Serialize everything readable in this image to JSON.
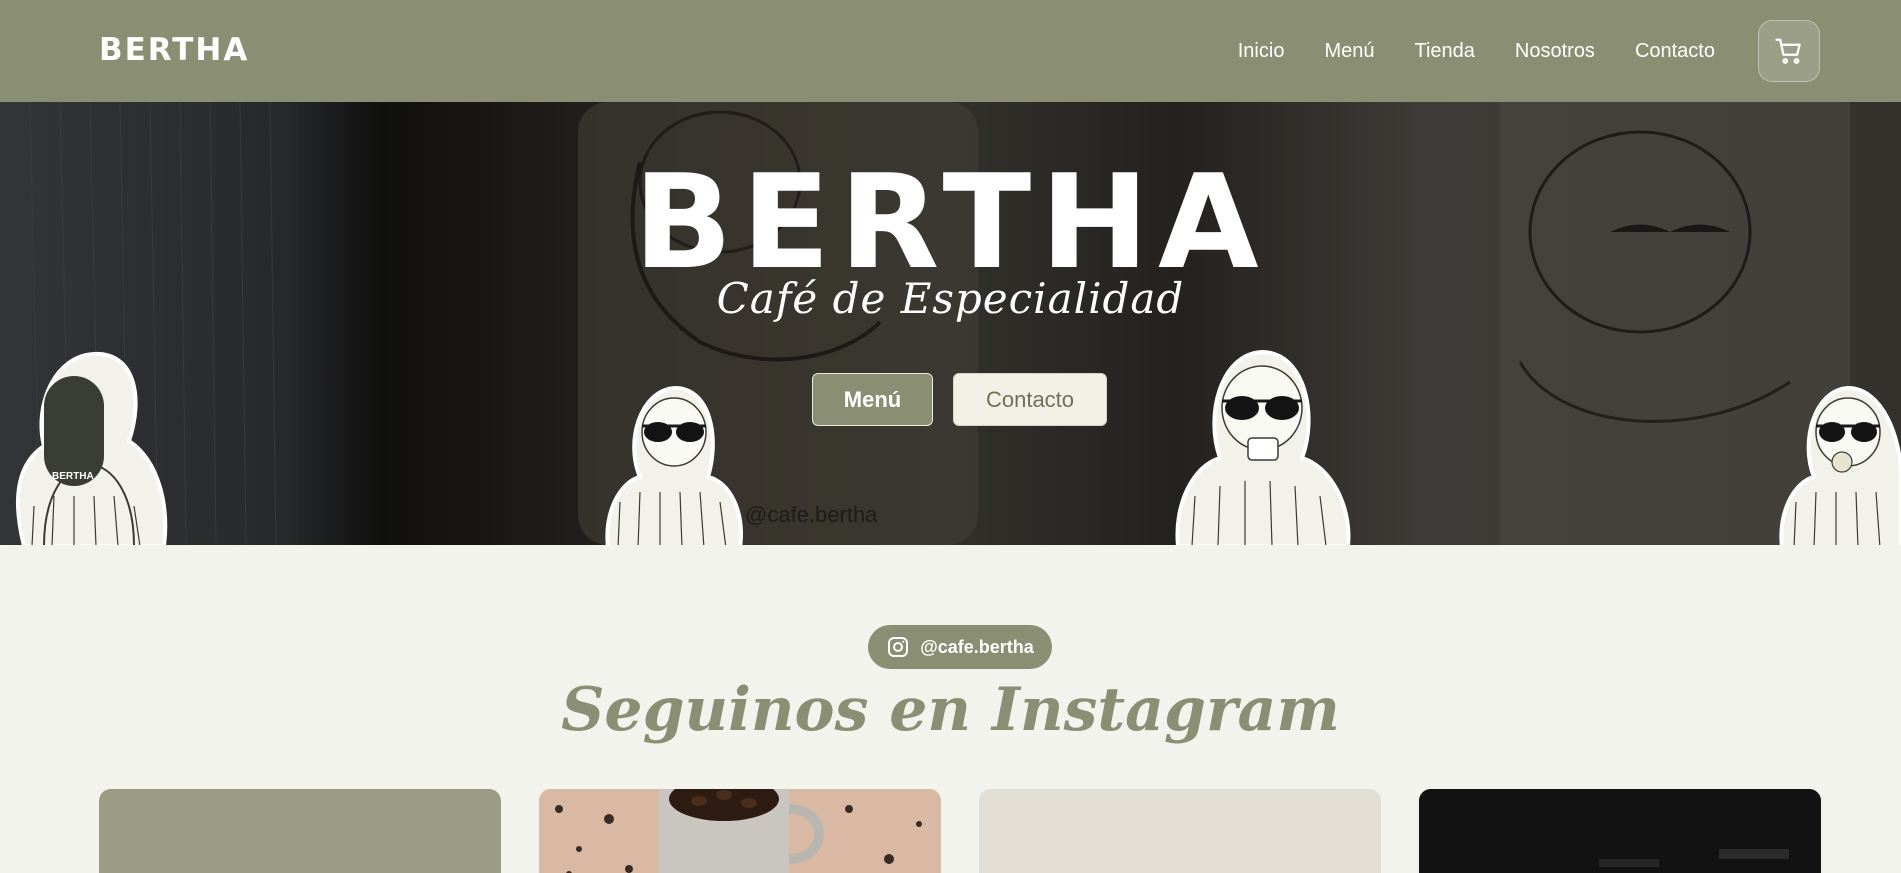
{
  "nav": {
    "logo": "BERTHA",
    "links": [
      "Inicio",
      "Menú",
      "Tienda",
      "Nosotros",
      "Contacto"
    ],
    "cart_icon": "cart-icon"
  },
  "hero": {
    "title": "BERTHA",
    "subtitle": "Café de Especialidad",
    "primary_button": "Menú",
    "secondary_button": "Contacto",
    "cup_handle_text": "@cafe.bertha",
    "sticker_bag_text": "BERTHA"
  },
  "instagram": {
    "handle": "@cafe.bertha",
    "icon": "instagram-icon",
    "title": "Seguinos en Instagram"
  },
  "colors": {
    "brand": "#8a8f74",
    "background": "#f3f3ee",
    "hero_dark": "#2a2621"
  }
}
